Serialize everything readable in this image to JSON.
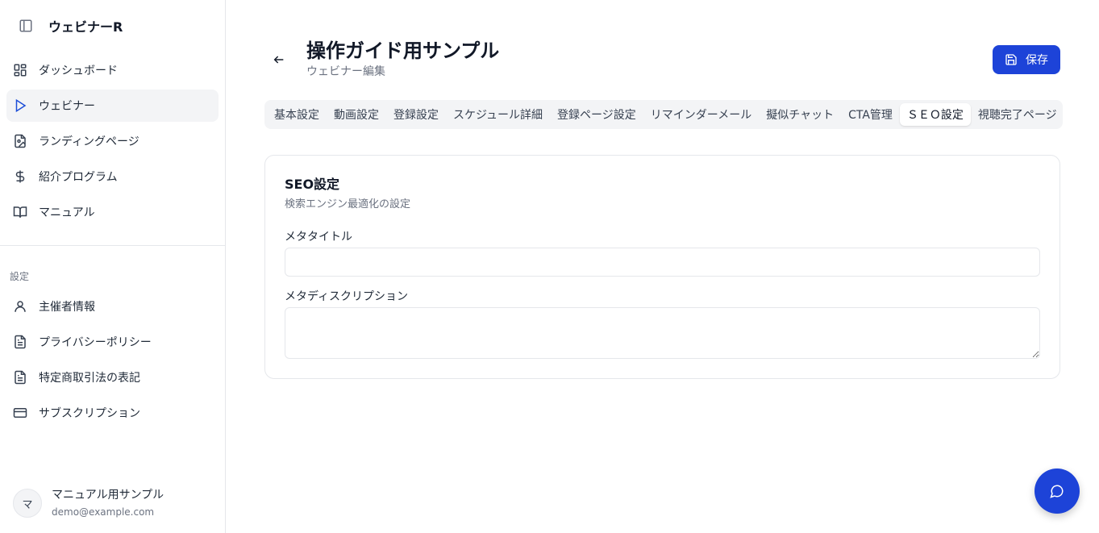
{
  "app": {
    "name": "ウェビナーR"
  },
  "sidebar": {
    "items": [
      {
        "label": "ダッシュボード"
      },
      {
        "label": "ウェビナー"
      },
      {
        "label": "ランディングページ"
      },
      {
        "label": "紹介プログラム"
      },
      {
        "label": "マニュアル"
      }
    ],
    "settings_label": "設定",
    "settings_items": [
      {
        "label": "主催者情報"
      },
      {
        "label": "プライバシーポリシー"
      },
      {
        "label": "特定商取引法の表記"
      },
      {
        "label": "サブスクリプション"
      }
    ],
    "user": {
      "initial": "マ",
      "name": "マニュアル用サンプル",
      "email": "demo@example.com"
    }
  },
  "header": {
    "title": "操作ガイド用サンプル",
    "subtitle": "ウェビナー編集",
    "save_label": "保存"
  },
  "tabs": [
    {
      "label": "基本設定"
    },
    {
      "label": "動画設定"
    },
    {
      "label": "登録設定"
    },
    {
      "label": "スケジュール詳細"
    },
    {
      "label": "登録ページ設定"
    },
    {
      "label": "リマインダーメール"
    },
    {
      "label": "擬似チャット"
    },
    {
      "label": "CTA管理"
    },
    {
      "label": "ＳＥＯ設定"
    },
    {
      "label": "視聴完了ページ"
    }
  ],
  "active_tab": "ＳＥＯ設定",
  "seo_card": {
    "title": "SEO設定",
    "description": "検索エンジン最適化の設定",
    "meta_title_label": "メタタイトル",
    "meta_title_value": "",
    "meta_description_label": "メタディスクリプション",
    "meta_description_value": ""
  },
  "colors": {
    "primary": "#1d43d8",
    "active_nav_bg": "#f3f4f6",
    "border": "#e5e7eb",
    "muted_text": "#6b7280"
  },
  "icons": {
    "sidebar_toggle": "panel-left-icon",
    "dashboard": "layout-grid-icon",
    "webinar": "play-icon",
    "landing": "file-image-icon",
    "referral": "dollar-icon",
    "manual": "book-open-icon",
    "organizer": "user-icon",
    "privacy": "file-text-icon",
    "commerce": "file-text-icon",
    "subscription": "credit-card-icon",
    "back": "arrow-left-icon",
    "save": "save-icon",
    "chat": "message-circle-icon"
  }
}
